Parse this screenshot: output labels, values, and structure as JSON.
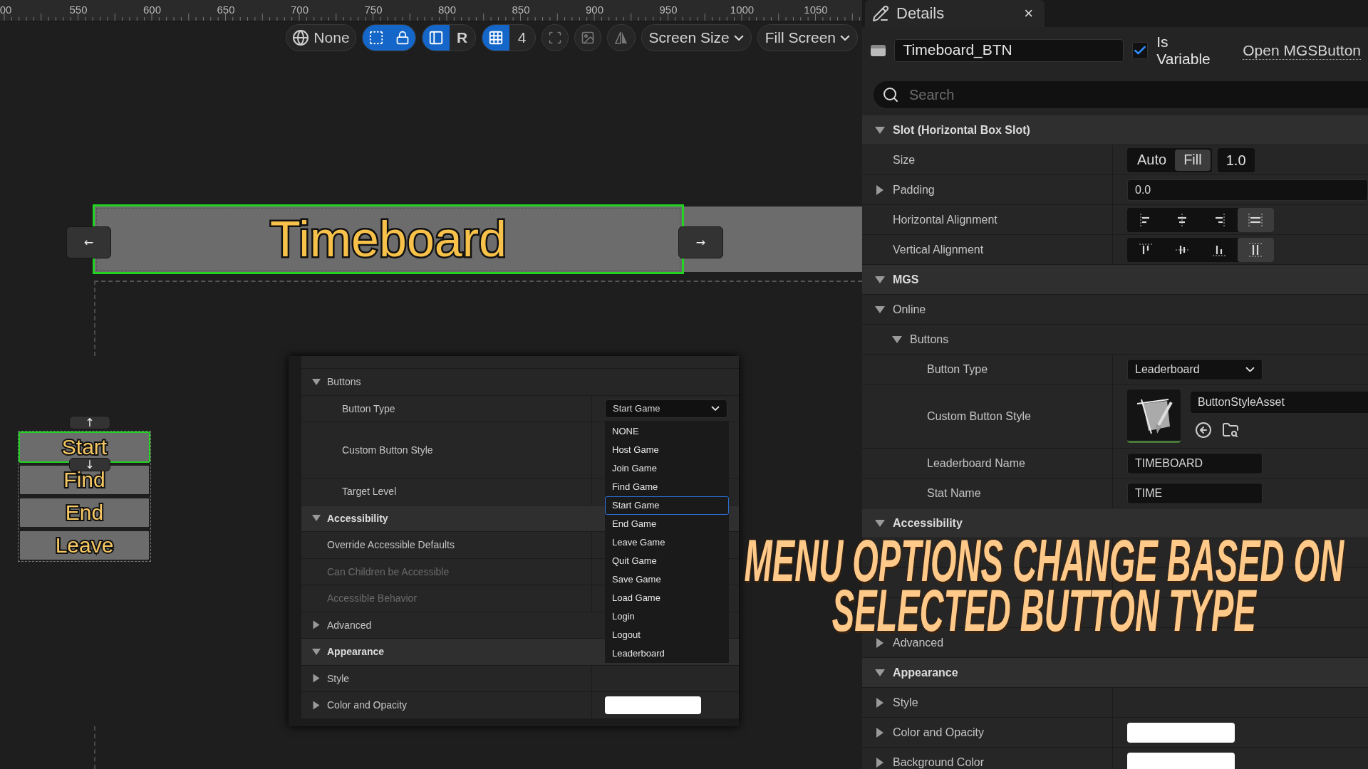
{
  "ruler": {
    "labels": [
      "00",
      "550",
      "600",
      "650",
      "700",
      "750",
      "800",
      "850",
      "900",
      "950",
      "1000",
      "1050"
    ]
  },
  "toolbar": {
    "preview": "None",
    "select_tools": [
      {
        "kind": "marquee",
        "on": true
      },
      {
        "kind": "lock",
        "on": true
      }
    ],
    "layout_tools": [
      {
        "kind": "layout",
        "on": true
      },
      {
        "kind": "letter",
        "label": "R",
        "on": false
      }
    ],
    "grid": {
      "on": true,
      "size": "4"
    },
    "view_tools": [
      {
        "kind": "fit",
        "on": false
      },
      {
        "kind": "image",
        "on": false
      },
      {
        "kind": "mirror",
        "on": false
      }
    ],
    "screen_size": "Screen Size",
    "fill_mode": "Fill Screen"
  },
  "canvas": {
    "title_widget": {
      "label": "Timeboard",
      "selected": true
    },
    "nav_arrows": [
      "←",
      "→"
    ],
    "menu_buttons": [
      {
        "label": "Start",
        "selected": true
      },
      {
        "label": "Find",
        "selected": false
      },
      {
        "label": "End",
        "selected": false
      },
      {
        "label": "Leave",
        "selected": false
      }
    ],
    "reorder_arrows": [
      "↑",
      "↓"
    ]
  },
  "inset_panel": {
    "tree": [
      {
        "kind": "group",
        "label": "Buttons",
        "expanded": true,
        "children": [
          {
            "kind": "property",
            "label": "Button Type",
            "value": {
              "kind": "dropdown",
              "text": "Start Game",
              "open": true,
              "options": [
                {
                  "label": "NONE",
                  "selected": false
                },
                {
                  "label": "Host Game",
                  "selected": false
                },
                {
                  "label": "Join Game",
                  "selected": false
                },
                {
                  "label": "Find Game",
                  "selected": false
                },
                {
                  "label": "Start Game",
                  "selected": true
                },
                {
                  "label": "End Game",
                  "selected": false
                },
                {
                  "label": "Leave Game",
                  "selected": false
                },
                {
                  "label": "Quit Game",
                  "selected": false
                },
                {
                  "label": "Save Game",
                  "selected": false
                },
                {
                  "label": "Load Game",
                  "selected": false
                },
                {
                  "label": "Login",
                  "selected": false
                },
                {
                  "label": "Logout",
                  "selected": false
                },
                {
                  "label": "Leaderboard",
                  "selected": false
                }
              ]
            }
          },
          {
            "kind": "property",
            "label": "Custom Button Style",
            "tall": true
          },
          {
            "kind": "property",
            "label": "Target Level"
          }
        ]
      },
      {
        "kind": "section",
        "label": "Accessibility",
        "expanded": true,
        "children": [
          {
            "kind": "property",
            "label": "Override Accessible Defaults",
            "disabled": false
          },
          {
            "kind": "property",
            "label": "Can Children be Accessible",
            "disabled": true
          },
          {
            "kind": "property",
            "label": "Accessible Behavior",
            "disabled": true
          }
        ]
      },
      {
        "kind": "group",
        "label": "Advanced",
        "expanded": false
      },
      {
        "kind": "section",
        "label": "Appearance",
        "expanded": true,
        "children": [
          {
            "kind": "property",
            "label": "Style",
            "expanded": false
          },
          {
            "kind": "property",
            "label": "Color and Opacity",
            "expanded": false,
            "value": {
              "kind": "swatch"
            }
          }
        ]
      }
    ]
  },
  "details": {
    "tab": {
      "title": "Details",
      "close": "×"
    },
    "widget_name": "Timeboard_BTN",
    "is_variable": {
      "label": "Is Variable",
      "checked": true
    },
    "open_link": "Open MGSButton",
    "search": {
      "placeholder": "Search"
    },
    "tree": [
      {
        "kind": "section",
        "label": "Slot (Horizontal Box Slot)",
        "expanded": true,
        "children": [
          {
            "kind": "property",
            "label": "Size",
            "value": {
              "kind": "size",
              "options": [
                {
                  "label": "Auto",
                  "selected": false
                },
                {
                  "label": "Fill",
                  "selected": true
                }
              ],
              "field": "1.0"
            }
          },
          {
            "kind": "property",
            "label": "Padding",
            "expanded": false,
            "value": {
              "kind": "field",
              "text": "0.0",
              "wide": true
            }
          },
          {
            "kind": "property",
            "label": "Horizontal Alignment",
            "value": {
              "kind": "h_align",
              "options": [
                {
                  "selected": false
                },
                {
                  "selected": false
                },
                {
                  "selected": false
                },
                {
                  "selected": true
                }
              ]
            }
          },
          {
            "kind": "property",
            "label": "Vertical Alignment",
            "value": {
              "kind": "v_align",
              "options": [
                {
                  "selected": false
                },
                {
                  "selected": false
                },
                {
                  "selected": false
                },
                {
                  "selected": true
                }
              ]
            }
          }
        ]
      },
      {
        "kind": "section",
        "label": "MGS",
        "expanded": true,
        "children": [
          {
            "kind": "group",
            "label": "Online",
            "expanded": true,
            "children": [
              {
                "kind": "group",
                "label": "Buttons",
                "expanded": true,
                "children": [
                  {
                    "kind": "property",
                    "label": "Button Type",
                    "value": {
                      "kind": "select",
                      "text": "Leaderboard"
                    }
                  },
                  {
                    "kind": "property",
                    "label": "Custom Button Style",
                    "tall": true,
                    "value": {
                      "kind": "asset",
                      "text": "ButtonStyleAsset"
                    }
                  },
                  {
                    "kind": "property",
                    "label": "Leaderboard Name",
                    "value": {
                      "kind": "field",
                      "text": "TIMEBOARD",
                      "wide": false
                    }
                  },
                  {
                    "kind": "property",
                    "label": "Stat Name",
                    "value": {
                      "kind": "field",
                      "text": "TIME",
                      "wide": false
                    }
                  }
                ]
              }
            ]
          }
        ]
      },
      {
        "kind": "section",
        "label": "Accessibility",
        "expanded": true,
        "children": [
          {
            "kind": "property"
          },
          {
            "kind": "property"
          },
          {
            "kind": "property"
          }
        ]
      },
      {
        "kind": "group",
        "label": "Advanced",
        "expanded": false
      },
      {
        "kind": "section",
        "label": "Appearance",
        "expanded": true,
        "children": [
          {
            "kind": "property",
            "label": "Style",
            "expanded": false
          },
          {
            "kind": "property",
            "label": "Color and Opacity",
            "expanded": false,
            "value": {
              "kind": "swatch"
            }
          },
          {
            "kind": "property",
            "label": "Background Color",
            "expanded": false,
            "value": {
              "kind": "swatch"
            }
          }
        ]
      }
    ]
  },
  "caption": [
    "MENU OPTIONS CHANGE BASED ON",
    "SELECTED BUTTON TYPE"
  ]
}
